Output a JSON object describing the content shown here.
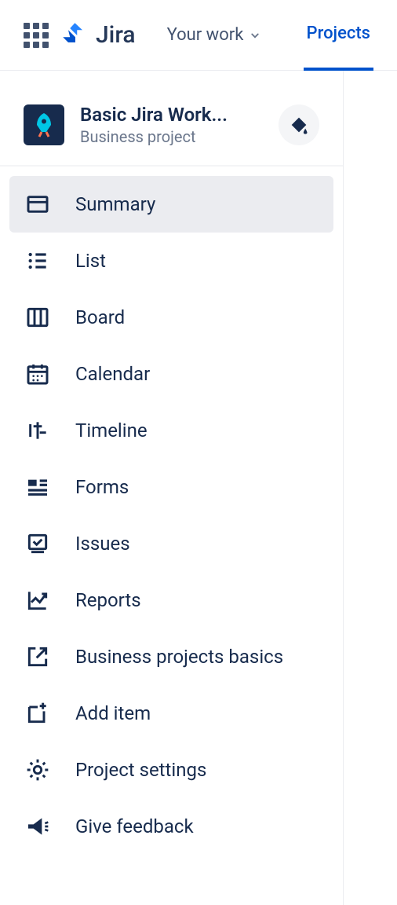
{
  "header": {
    "product": "Jira",
    "nav_your_work": "Your work",
    "nav_projects": "Projects"
  },
  "project": {
    "name": "Basic Jira Work...",
    "type": "Business project"
  },
  "sidebar": {
    "items": [
      {
        "label": "Summary",
        "icon": "window-icon",
        "selected": true
      },
      {
        "label": "List",
        "icon": "list-icon",
        "selected": false
      },
      {
        "label": "Board",
        "icon": "board-icon",
        "selected": false
      },
      {
        "label": "Calendar",
        "icon": "calendar-icon",
        "selected": false
      },
      {
        "label": "Timeline",
        "icon": "timeline-icon",
        "selected": false
      },
      {
        "label": "Forms",
        "icon": "forms-icon",
        "selected": false
      },
      {
        "label": "Issues",
        "icon": "issues-icon",
        "selected": false
      },
      {
        "label": "Reports",
        "icon": "reports-icon",
        "selected": false
      },
      {
        "label": "Business projects basics",
        "icon": "external-link-icon",
        "selected": false
      },
      {
        "label": "Add item",
        "icon": "add-page-icon",
        "selected": false
      },
      {
        "label": "Project settings",
        "icon": "gear-icon",
        "selected": false
      },
      {
        "label": "Give feedback",
        "icon": "megaphone-icon",
        "selected": false
      }
    ]
  }
}
